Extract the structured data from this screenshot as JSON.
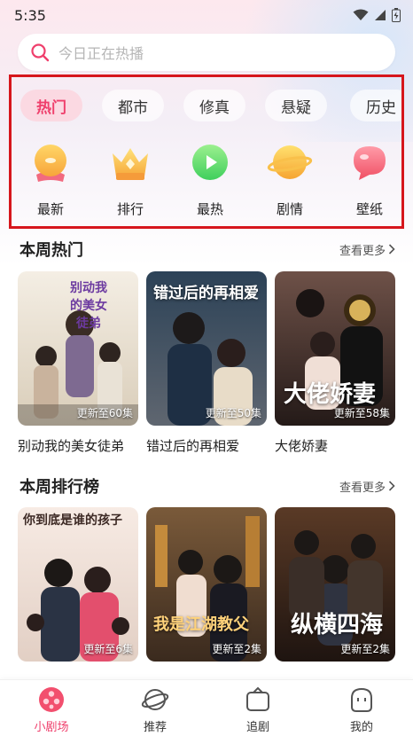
{
  "status_bar": {
    "time": "5:35"
  },
  "search": {
    "placeholder": "今日正在热播"
  },
  "tabs": [
    {
      "label": "热门",
      "active": true
    },
    {
      "label": "都市"
    },
    {
      "label": "修真"
    },
    {
      "label": "悬疑"
    },
    {
      "label": "历史"
    }
  ],
  "categories": [
    {
      "label": "最新",
      "icon": "new-icon"
    },
    {
      "label": "排行",
      "icon": "crown-icon"
    },
    {
      "label": "最热",
      "icon": "play-icon"
    },
    {
      "label": "剧情",
      "icon": "planet-icon"
    },
    {
      "label": "壁纸",
      "icon": "wallpaper-icon"
    }
  ],
  "weekly_hot": {
    "title": "本周热门",
    "more": "查看更多",
    "items": [
      {
        "name": "别动我的美女徒弟",
        "episodes": "更新至60集",
        "poster_text": "别动我的美女徒弟"
      },
      {
        "name": "错过后的再相爱",
        "episodes": "更新至50集",
        "poster_text": "错过后的再相爱"
      },
      {
        "name": "大佬娇妻",
        "episodes": "更新至58集",
        "poster_text": "大佬娇妻"
      }
    ]
  },
  "weekly_rank": {
    "title": "本周排行榜",
    "more": "查看更多",
    "items": [
      {
        "episodes": "更新至6集",
        "poster_text": "你到底是谁的孩子"
      },
      {
        "episodes": "更新至2集",
        "poster_text": "我是江湖教父"
      },
      {
        "episodes": "更新至2集",
        "poster_text": "纵横四海"
      }
    ]
  },
  "bottom_nav": [
    {
      "label": "小剧场",
      "icon": "theater-icon",
      "active": true
    },
    {
      "label": "推荐",
      "icon": "recommend-icon"
    },
    {
      "label": "追剧",
      "icon": "follow-icon"
    },
    {
      "label": "我的",
      "icon": "profile-icon"
    }
  ],
  "colors": {
    "accent": "#ef3f6c",
    "highlight_border": "#d6161c"
  }
}
